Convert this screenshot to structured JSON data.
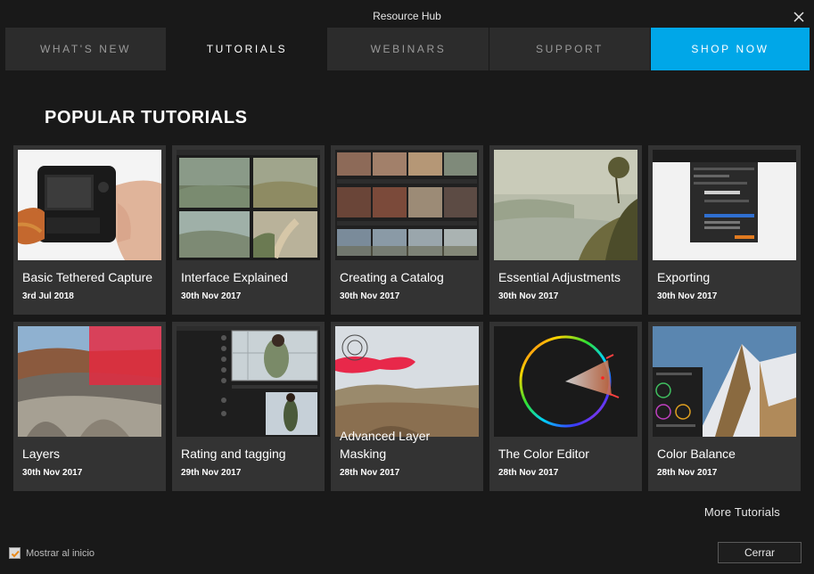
{
  "window": {
    "title": "Resource Hub"
  },
  "tabs": [
    {
      "label": "WHAT'S NEW",
      "state": "normal"
    },
    {
      "label": "TUTORIALS",
      "state": "active"
    },
    {
      "label": "WEBINARS",
      "state": "normal"
    },
    {
      "label": "SUPPORT",
      "state": "normal"
    },
    {
      "label": "SHOP NOW",
      "state": "accent"
    }
  ],
  "section": {
    "heading": "POPULAR TUTORIALS"
  },
  "tutorials": [
    {
      "title": "Basic Tethered Capture",
      "date": "3rd Jul 2018",
      "thumb": "camera-in-hand"
    },
    {
      "title": "Interface Explained",
      "date": "30th Nov 2017",
      "thumb": "app-interface-landscapes"
    },
    {
      "title": "Creating a Catalog",
      "date": "30th Nov 2017",
      "thumb": "catalog-browser-grid"
    },
    {
      "title": "Essential Adjustments",
      "date": "30th Nov 2017",
      "thumb": "misty-lake-landscape"
    },
    {
      "title": "Exporting",
      "date": "30th Nov 2017",
      "thumb": "export-dialog"
    },
    {
      "title": "Layers",
      "date": "30th Nov 2017",
      "thumb": "desert-badlands-red-layer"
    },
    {
      "title": "Rating and tagging",
      "date": "29th Nov 2017",
      "thumb": "portrait-rating-browser"
    },
    {
      "title": "Advanced Layer Masking",
      "date": "28th Nov 2017",
      "thumb": "desert-mask-brush"
    },
    {
      "title": "The Color Editor",
      "date": "28th Nov 2017",
      "thumb": "color-wheel"
    },
    {
      "title": "Color Balance",
      "date": "28th Nov 2017",
      "thumb": "snowy-mountain-color-balance"
    }
  ],
  "links": {
    "more": "More Tutorials"
  },
  "footer": {
    "show_on_start_label": "Mostrar al inicio",
    "show_on_start_checked": true,
    "close_label": "Cerrar"
  },
  "colors": {
    "accent": "#00a7e8",
    "background": "#191919",
    "tab": "#2c2c2c",
    "card": "#333333",
    "check": "#e8891a"
  }
}
